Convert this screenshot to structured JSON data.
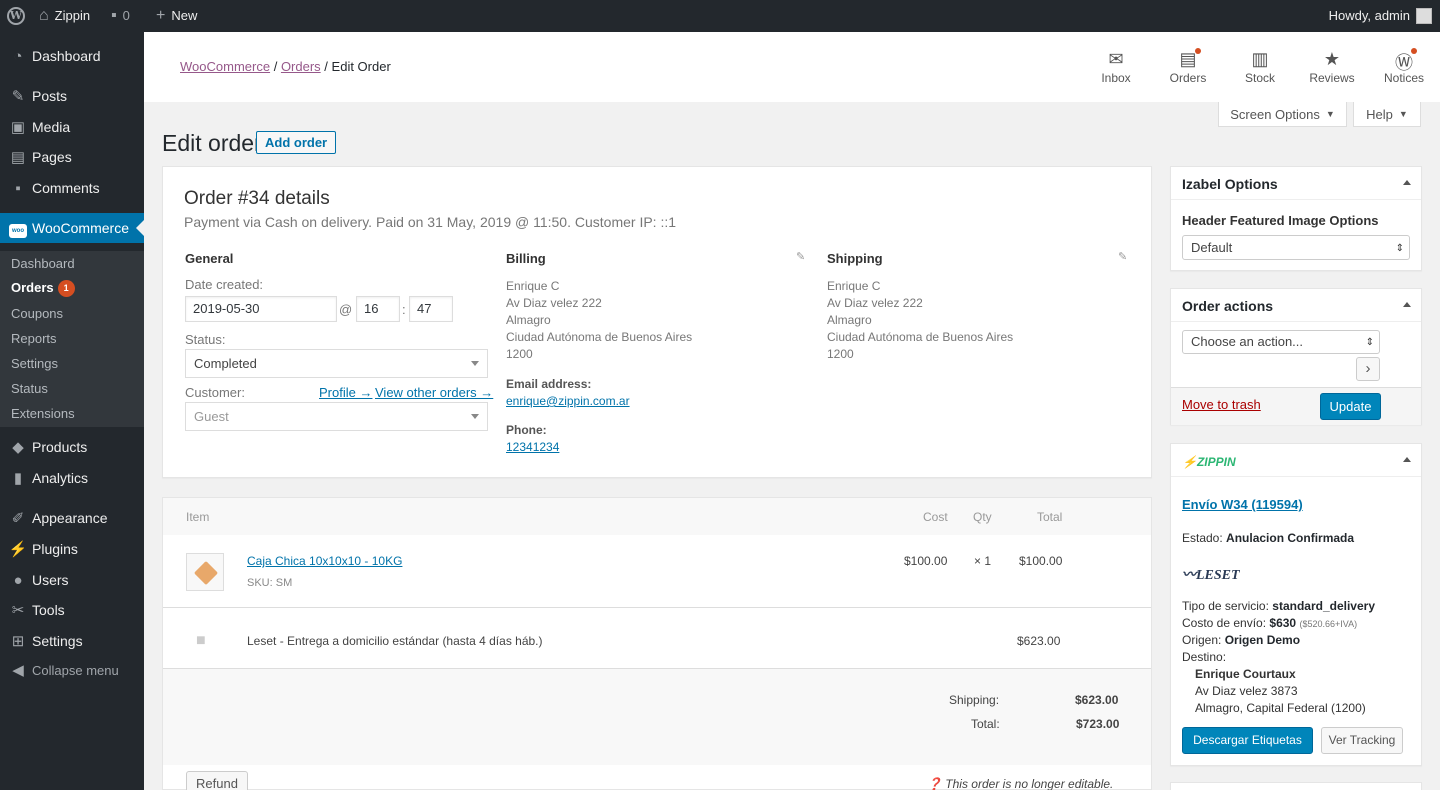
{
  "adminbar": {
    "site": "Zippin",
    "comments": "0",
    "new": "New",
    "howdy": "Howdy, admin"
  },
  "sidebar": {
    "items": [
      {
        "label": "Dashboard",
        "icon": "dashboard-icon"
      },
      {
        "label": "Posts",
        "icon": "pin-icon"
      },
      {
        "label": "Media",
        "icon": "media-icon"
      },
      {
        "label": "Pages",
        "icon": "pages-icon"
      },
      {
        "label": "Comments",
        "icon": "comments-icon"
      },
      {
        "label": "WooCommerce",
        "icon": "woo-icon"
      },
      {
        "label": "Products",
        "icon": "products-icon"
      },
      {
        "label": "Analytics",
        "icon": "analytics-icon"
      },
      {
        "label": "Appearance",
        "icon": "brush-icon"
      },
      {
        "label": "Plugins",
        "icon": "plugin-icon"
      },
      {
        "label": "Users",
        "icon": "users-icon"
      },
      {
        "label": "Tools",
        "icon": "wrench-icon"
      },
      {
        "label": "Settings",
        "icon": "settings-icon"
      },
      {
        "label": "Collapse menu",
        "icon": "collapse-icon"
      }
    ],
    "woo_badge": "woo",
    "submenu": [
      "Dashboard",
      "Orders",
      "Coupons",
      "Reports",
      "Settings",
      "Status",
      "Extensions"
    ],
    "orders_count": "1"
  },
  "header": {
    "breadcrumb": {
      "woocommerce": "WooCommerce",
      "sep1": "/",
      "orders": "Orders",
      "sep2": "/",
      "current": "Edit Order"
    },
    "tools": [
      "Inbox",
      "Orders",
      "Stock",
      "Reviews",
      "Notices"
    ]
  },
  "screen_options": "Screen Options",
  "help": "Help",
  "title": "Edit order",
  "add_order": "Add order",
  "order": {
    "heading": "Order #34 details",
    "meta": "Payment via Cash on delivery. Paid on 31 May, 2019 @ 11:50. Customer IP: ::1",
    "general": "General",
    "date_label": "Date created:",
    "date": "2019-05-30",
    "at": "@",
    "hour": "16",
    "colon": ":",
    "minute": "47",
    "status_label": "Status:",
    "status": "Completed",
    "customer_label": "Customer:",
    "profile_link": "Profile →",
    "other_orders_link": "View other orders →",
    "customer": "Guest",
    "billing": {
      "heading": "Billing",
      "lines": [
        "Enrique C",
        "Av Diaz velez 222",
        "Almagro",
        "Ciudad Autónoma de Buenos Aires",
        "1200"
      ],
      "email_label": "Email address:",
      "email": "enrique@zippin.com.ar",
      "phone_label": "Phone:",
      "phone": "12341234"
    },
    "shipping": {
      "heading": "Shipping",
      "lines": [
        "Enrique C",
        "Av Diaz velez 222",
        "Almagro",
        "Ciudad Autónoma de Buenos Aires",
        "1200"
      ]
    }
  },
  "items": {
    "headers": {
      "item": "Item",
      "cost": "Cost",
      "qty": "Qty",
      "total": "Total"
    },
    "product": {
      "name": "Caja Chica 10x10x10 - 10KG",
      "sku_label": "SKU:",
      "sku": "SM",
      "cost": "$100.00",
      "qty": "× 1",
      "total": "$100.00"
    },
    "shipping_line": {
      "name": "Leset - Entrega a domicilio estándar (hasta 4 días háb.)",
      "total": "$623.00"
    },
    "totals": {
      "shipping_label": "Shipping:",
      "shipping": "$623.00",
      "total_label": "Total:",
      "total": "$723.00"
    },
    "refund": "Refund",
    "not_editable": "This order is no longer editable."
  },
  "izabel": {
    "title": "Izabel Options",
    "field_label": "Header Featured Image Options",
    "value": "Default"
  },
  "order_actions": {
    "title": "Order actions",
    "select": "Choose an action...",
    "go": "›",
    "trash": "Move to trash",
    "update": "Update"
  },
  "zippin": {
    "brand": "ZIPPIN",
    "envio_link": "Envío W34 (119594)",
    "estado_label": "Estado:",
    "estado": "Anulacion Confirmada",
    "carrier_logo": "LESET",
    "servicio_label": "Tipo de servicio:",
    "servicio": "standard_delivery",
    "costo_label": "Costo de envío:",
    "costo": "$630",
    "costo_detalle": "($520.66+IVA)",
    "origen_label": "Origen:",
    "origen": "Origen Demo",
    "destino_label": "Destino:",
    "destino_nombre": "Enrique Courtaux",
    "destino_calle": "Av Diaz velez 3873",
    "destino_ciudad": "Almagro, Capital Federal (1200)",
    "descargar": "Descargar Etiquetas",
    "tracking": "Ver Tracking"
  },
  "colors": {
    "wp_blue": "#0073aa",
    "admin_dark": "#23282d",
    "woo_purple": "#96588a",
    "notice_red": "#d54e21"
  }
}
